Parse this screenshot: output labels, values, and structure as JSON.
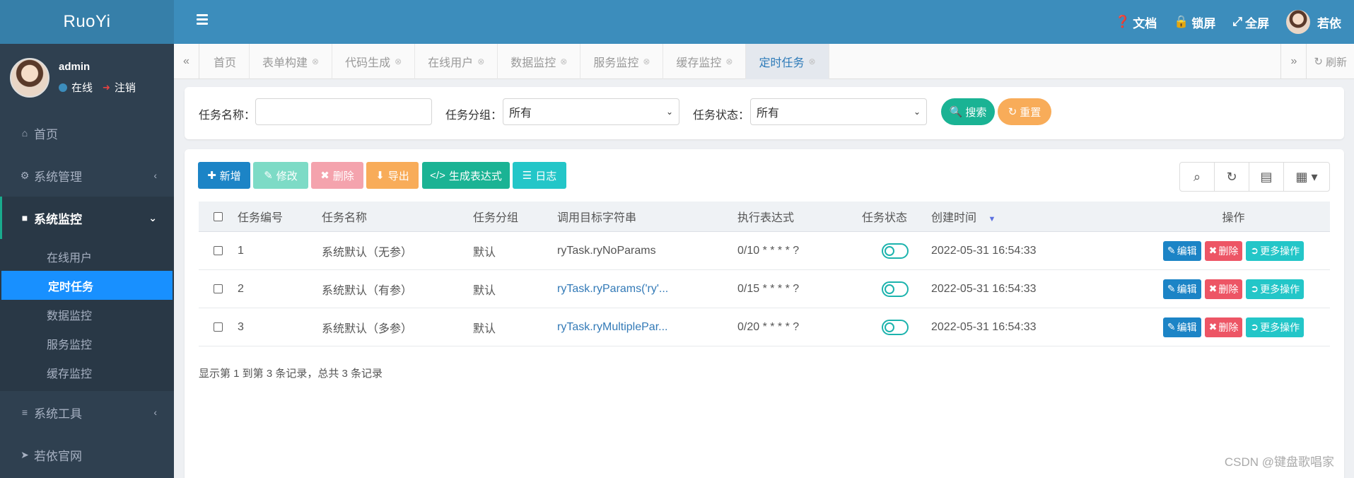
{
  "app": {
    "logo": "RuoYi"
  },
  "user": {
    "name": "admin",
    "status": "在线",
    "logout": "注销"
  },
  "sidebar": {
    "items": [
      {
        "icon": "home-icon",
        "label": "首页"
      },
      {
        "icon": "gear-icon",
        "label": "系统管理"
      },
      {
        "icon": "video-icon",
        "label": "系统监控"
      },
      {
        "icon": "bars-icon",
        "label": "系统工具"
      },
      {
        "icon": "send-icon",
        "label": "若依官网"
      }
    ],
    "submenu": [
      "在线用户",
      "定时任务",
      "数据监控",
      "服务监控",
      "缓存监控"
    ]
  },
  "header": {
    "docs": "文档",
    "lock": "锁屏",
    "fullscreen": "全屏",
    "username": "若依"
  },
  "tabs": [
    "首页",
    "表单构建",
    "代码生成",
    "在线用户",
    "数据监控",
    "服务监控",
    "缓存监控",
    "定时任务"
  ],
  "tab_refresh": "刷新",
  "search": {
    "job_name_label": "任务名称：",
    "job_name_value": "",
    "job_group_label": "任务分组：",
    "job_group_value": "所有",
    "job_status_label": "任务状态：",
    "job_status_value": "所有",
    "search_btn": "搜索",
    "reset_btn": "重置"
  },
  "toolbar": {
    "add": "新增",
    "edit": "修改",
    "delete": "删除",
    "export": "导出",
    "cron": "生成表达式",
    "log": "日志"
  },
  "table": {
    "headers": [
      "任务编号",
      "任务名称",
      "任务分组",
      "调用目标字符串",
      "执行表达式",
      "任务状态",
      "创建时间",
      "操作"
    ],
    "rows": [
      {
        "id": "1",
        "name": "系统默认（无参）",
        "group": "默认",
        "target": "ryTask.ryNoParams",
        "cron": "0/10 * * * * ?",
        "time": "2022-05-31 16:54:33"
      },
      {
        "id": "2",
        "name": "系统默认（有参）",
        "group": "默认",
        "target": "ryTask.ryParams('ry'...",
        "cron": "0/15 * * * * ?",
        "time": "2022-05-31 16:54:33"
      },
      {
        "id": "3",
        "name": "系统默认（多参）",
        "group": "默认",
        "target": "ryTask.ryMultiplePar...",
        "cron": "0/20 * * * * ?",
        "time": "2022-05-31 16:54:33"
      }
    ],
    "op_edit": "编辑",
    "op_delete": "删除",
    "op_more": "更多操作"
  },
  "pagination": {
    "summary": "显示第 1 到第 3 条记录，总共 3 条记录"
  },
  "watermark": "CSDN @键盘歌唱家",
  "colors": {
    "sidebar": "#2f4050",
    "header": "#3c8dbc",
    "active": "#1890ff",
    "green": "#1ab394",
    "orange": "#f8ac59",
    "red": "#ed5565",
    "blue": "#1c84c6",
    "teal": "#23c6c8"
  }
}
